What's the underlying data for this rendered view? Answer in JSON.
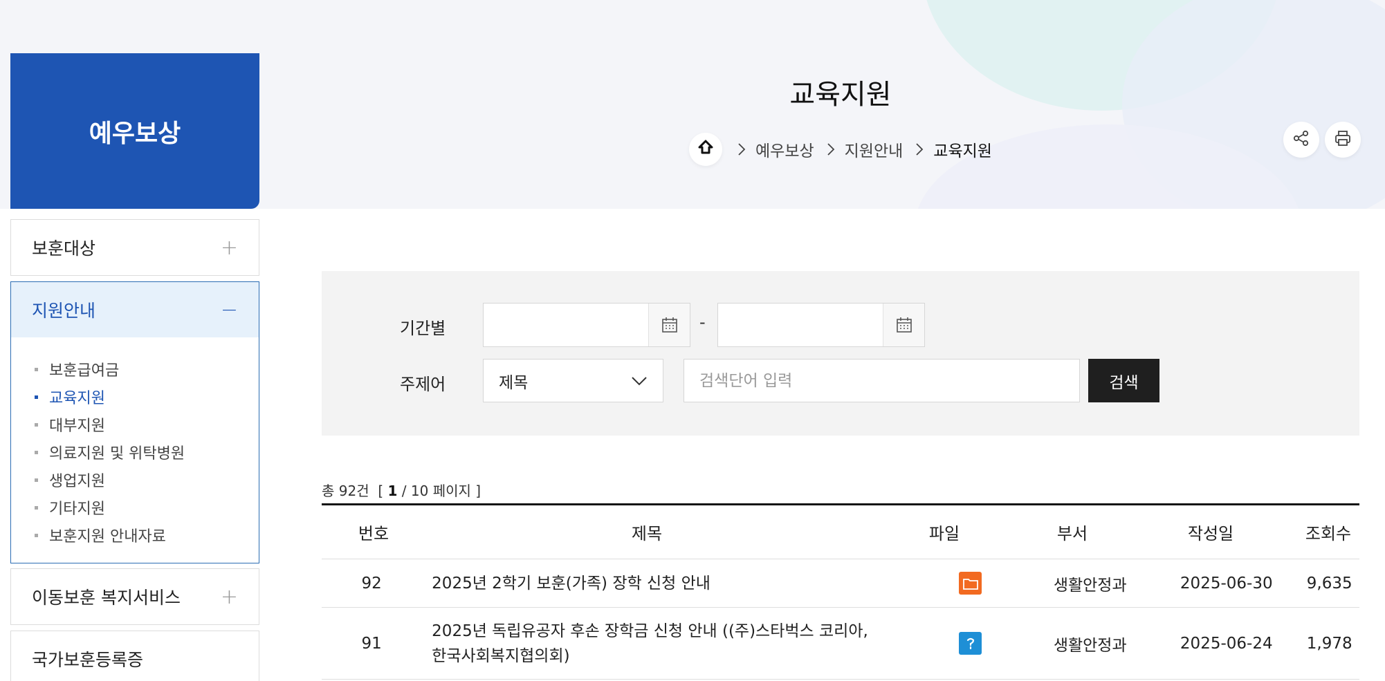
{
  "banner": {
    "title": "교육지원",
    "breadcrumb": [
      "예우보상",
      "지원안내",
      "교육지원"
    ]
  },
  "sidebar": {
    "heading": "예우보상",
    "items": [
      {
        "label": "보훈대상",
        "state": "collapsed",
        "symbol": "+"
      },
      {
        "label": "지원안내",
        "state": "expanded",
        "symbol": "−"
      },
      {
        "label": "이동보훈 복지서비스",
        "state": "collapsed",
        "symbol": "+"
      },
      {
        "label": "국가보훈등록증"
      }
    ],
    "subitems": [
      {
        "label": "보훈급여금"
      },
      {
        "label": "교육지원",
        "current": true
      },
      {
        "label": "대부지원"
      },
      {
        "label": "의료지원 및 위탁병원"
      },
      {
        "label": "생업지원"
      },
      {
        "label": "기타지원"
      },
      {
        "label": "보훈지원 안내자료"
      }
    ]
  },
  "search": {
    "period_label": "기간별",
    "date_separator": "-",
    "start_date_value": "",
    "end_date_value": "",
    "keyword_label": "주제어",
    "field_selected": "제목",
    "keyword_placeholder": "검색단어 입력",
    "keyword_value": "",
    "button_label": "검색"
  },
  "summary": {
    "prefix": "총",
    "total": "92건",
    "page_open": "[",
    "current_page": "1",
    "page_rest": "/ 10 페이지",
    "page_close": "]"
  },
  "table": {
    "headers": [
      "번호",
      "제목",
      "파일",
      "부서",
      "작성일",
      "조회수"
    ],
    "rows": [
      {
        "no": "92",
        "title_line1": "2025년 2학기 보훈(가족) 장학 신청 안내",
        "title_line2": "",
        "file_icon": "folder-icon",
        "file_color": "#f26a21",
        "dept": "생활안정과",
        "date": "2025-06-30",
        "views": "9,635"
      },
      {
        "no": "91",
        "title_line1": "2025년 독립유공자 후손 장학금 신청 안내 ((주)스타벅스 코리아,",
        "title_line2": "한국사회복지협의회)",
        "file_icon": "hwp-document-icon",
        "file_color": "#1e8fd6",
        "dept": "생활안정과",
        "date": "2025-06-24",
        "views": "1,978"
      }
    ]
  },
  "colors": {
    "brand_blue": "#1e55b3",
    "search_button": "#1f1f1f"
  }
}
